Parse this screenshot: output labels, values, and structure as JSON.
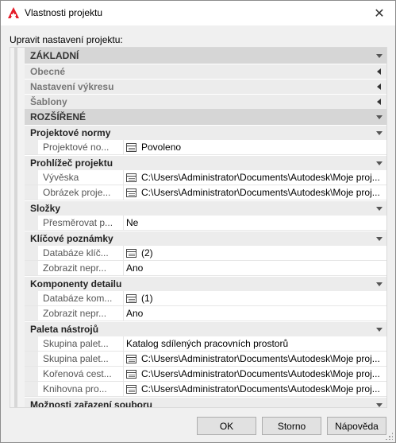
{
  "window": {
    "title": "Vlastnosti projektu",
    "close_glyph": "✕"
  },
  "prompt": "Upravit nastavení projektu:",
  "rows": [
    {
      "kind": "main",
      "label": "ZÁKLADNÍ",
      "arrow": "down"
    },
    {
      "kind": "collapsed",
      "label": "Obecné",
      "arrow": "left"
    },
    {
      "kind": "collapsed",
      "label": "Nastavení výkresu",
      "arrow": "left"
    },
    {
      "kind": "collapsed",
      "label": "Šablony",
      "arrow": "left"
    },
    {
      "kind": "main",
      "label": "ROZŠÍŘENÉ",
      "arrow": "down"
    },
    {
      "kind": "sub",
      "label": "Projektové normy",
      "arrow": "down"
    },
    {
      "kind": "prop",
      "name": "Projektové no...",
      "icon": "list-icon",
      "value": "Povoleno"
    },
    {
      "kind": "sub",
      "label": "Prohlížeč projektu",
      "arrow": "down"
    },
    {
      "kind": "prop",
      "name": "Vývěska",
      "icon": "list-icon",
      "value": "C:\\Users\\Administrator\\Documents\\Autodesk\\Moje  proj..."
    },
    {
      "kind": "prop",
      "name": "Obrázek proje...",
      "icon": "list-icon",
      "value": "C:\\Users\\Administrator\\Documents\\Autodesk\\Moje  proj..."
    },
    {
      "kind": "sub",
      "label": "Složky",
      "arrow": "down"
    },
    {
      "kind": "prop",
      "name": "Přesměrovat  p...",
      "icon": "",
      "value": "Ne"
    },
    {
      "kind": "sub",
      "label": "Klíčové poznámky",
      "arrow": "down"
    },
    {
      "kind": "prop",
      "name": "Databáze  klíč...",
      "icon": "list-icon",
      "value": "(2)"
    },
    {
      "kind": "prop",
      "name": "Zobrazit  nepr...",
      "icon": "",
      "value": "Ano"
    },
    {
      "kind": "sub",
      "label": "Komponenty detailu",
      "arrow": "down"
    },
    {
      "kind": "prop",
      "name": "Databáze  kom...",
      "icon": "list-icon",
      "value": "(1)"
    },
    {
      "kind": "prop",
      "name": "Zobrazit  nepr...",
      "icon": "",
      "value": "Ano"
    },
    {
      "kind": "sub",
      "label": "Paleta nástrojů",
      "arrow": "down"
    },
    {
      "kind": "prop",
      "name": "Skupina  palet...",
      "icon": "",
      "value": "Katalog sdílených pracovních prostorů"
    },
    {
      "kind": "prop",
      "name": "Skupina  palet...",
      "icon": "list-icon",
      "value": "C:\\Users\\Administrator\\Documents\\Autodesk\\Moje  proj..."
    },
    {
      "kind": "prop",
      "name": "Kořenová  cest...",
      "icon": "list-icon",
      "value": "C:\\Users\\Administrator\\Documents\\Autodesk\\Moje  proj..."
    },
    {
      "kind": "prop",
      "name": "Knihovna  pro...",
      "icon": "list-icon",
      "value": "C:\\Users\\Administrator\\Documents\\Autodesk\\Moje  proj..."
    },
    {
      "kind": "sub",
      "label": "Možnosti zařazení souboru",
      "arrow": "down"
    }
  ],
  "buttons": {
    "ok": "OK",
    "cancel": "Storno",
    "help": "Nápověda"
  },
  "colors": {
    "brand": "#e51d2a",
    "group_header": "#d6d6d6",
    "subgroup_header": "#ececec"
  }
}
